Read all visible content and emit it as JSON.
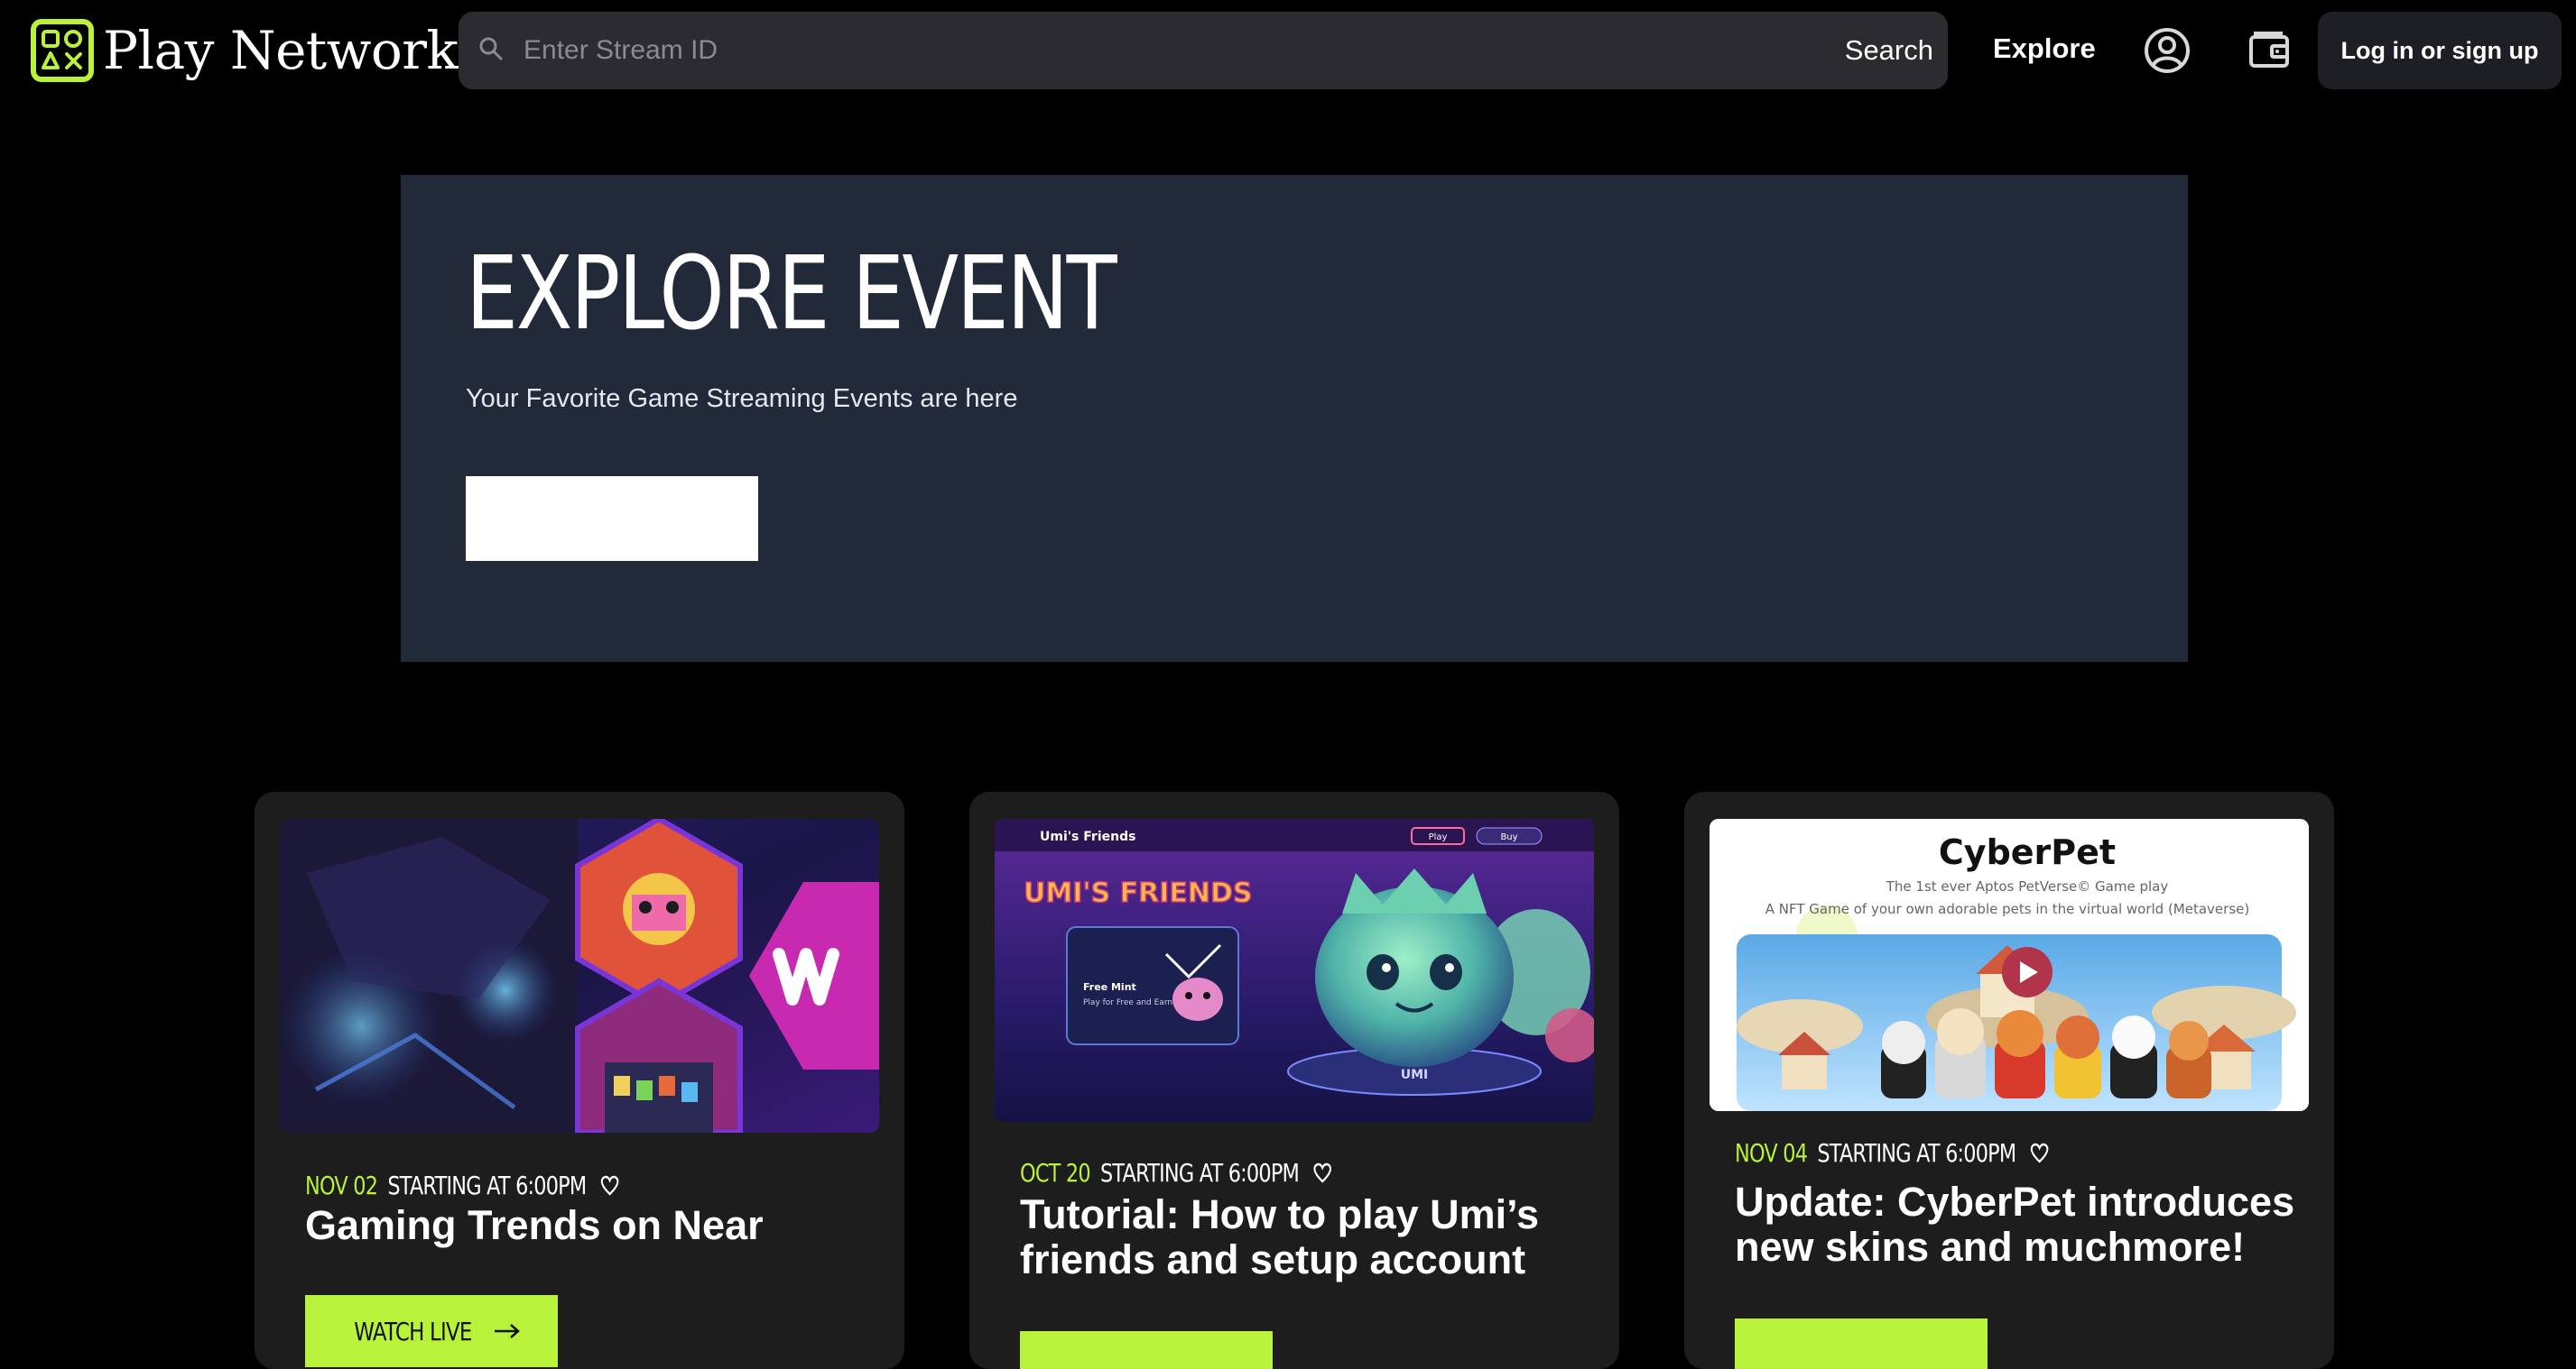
{
  "header": {
    "brand": "Play Network",
    "search": {
      "placeholder": "Enter Stream ID",
      "button_label": "Search"
    },
    "nav": {
      "explore_label": "Explore"
    },
    "login_label": "Log in or sign up"
  },
  "hero": {
    "title": "EXPLORE EVENT",
    "subtitle": "Your Favorite Game Streaming Events are here"
  },
  "cards": [
    {
      "date": "NOV 02",
      "time": "STARTING AT 6:00PM",
      "title": "Gaming Trends on Near",
      "button_label": "WATCH LIVE"
    },
    {
      "date": "OCT 20",
      "time": "STARTING AT 6:00PM",
      "title": "Tutorial: How to play Umi’s friends and setup account",
      "thumb_logo": "Umi's Friends",
      "thumb_heading": "UMI'S FRIENDS",
      "thumb_panel_line1": "Free Mint",
      "thumb_panel_line2": "Play for Free and Earn",
      "thumb_pill_1": "Play",
      "thumb_pill_2": "Buy",
      "thumb_badge": "UMI"
    },
    {
      "date": "NOV 04",
      "time": "STARTING AT 6:00PM",
      "title": "Update: CyberPet introduces new skins and muchmore!",
      "thumb_title": "CyberPet",
      "thumb_line1": "The 1st ever Aptos PetVerse© Game play",
      "thumb_line2": "A NFT Game of your own adorable pets in the virtual world (Metaverse)"
    }
  ],
  "colors": {
    "accent": "#b9f23a",
    "hero_bg": "#222a39",
    "card_bg": "#1d1d1d",
    "search_bg": "#2c2c30"
  }
}
